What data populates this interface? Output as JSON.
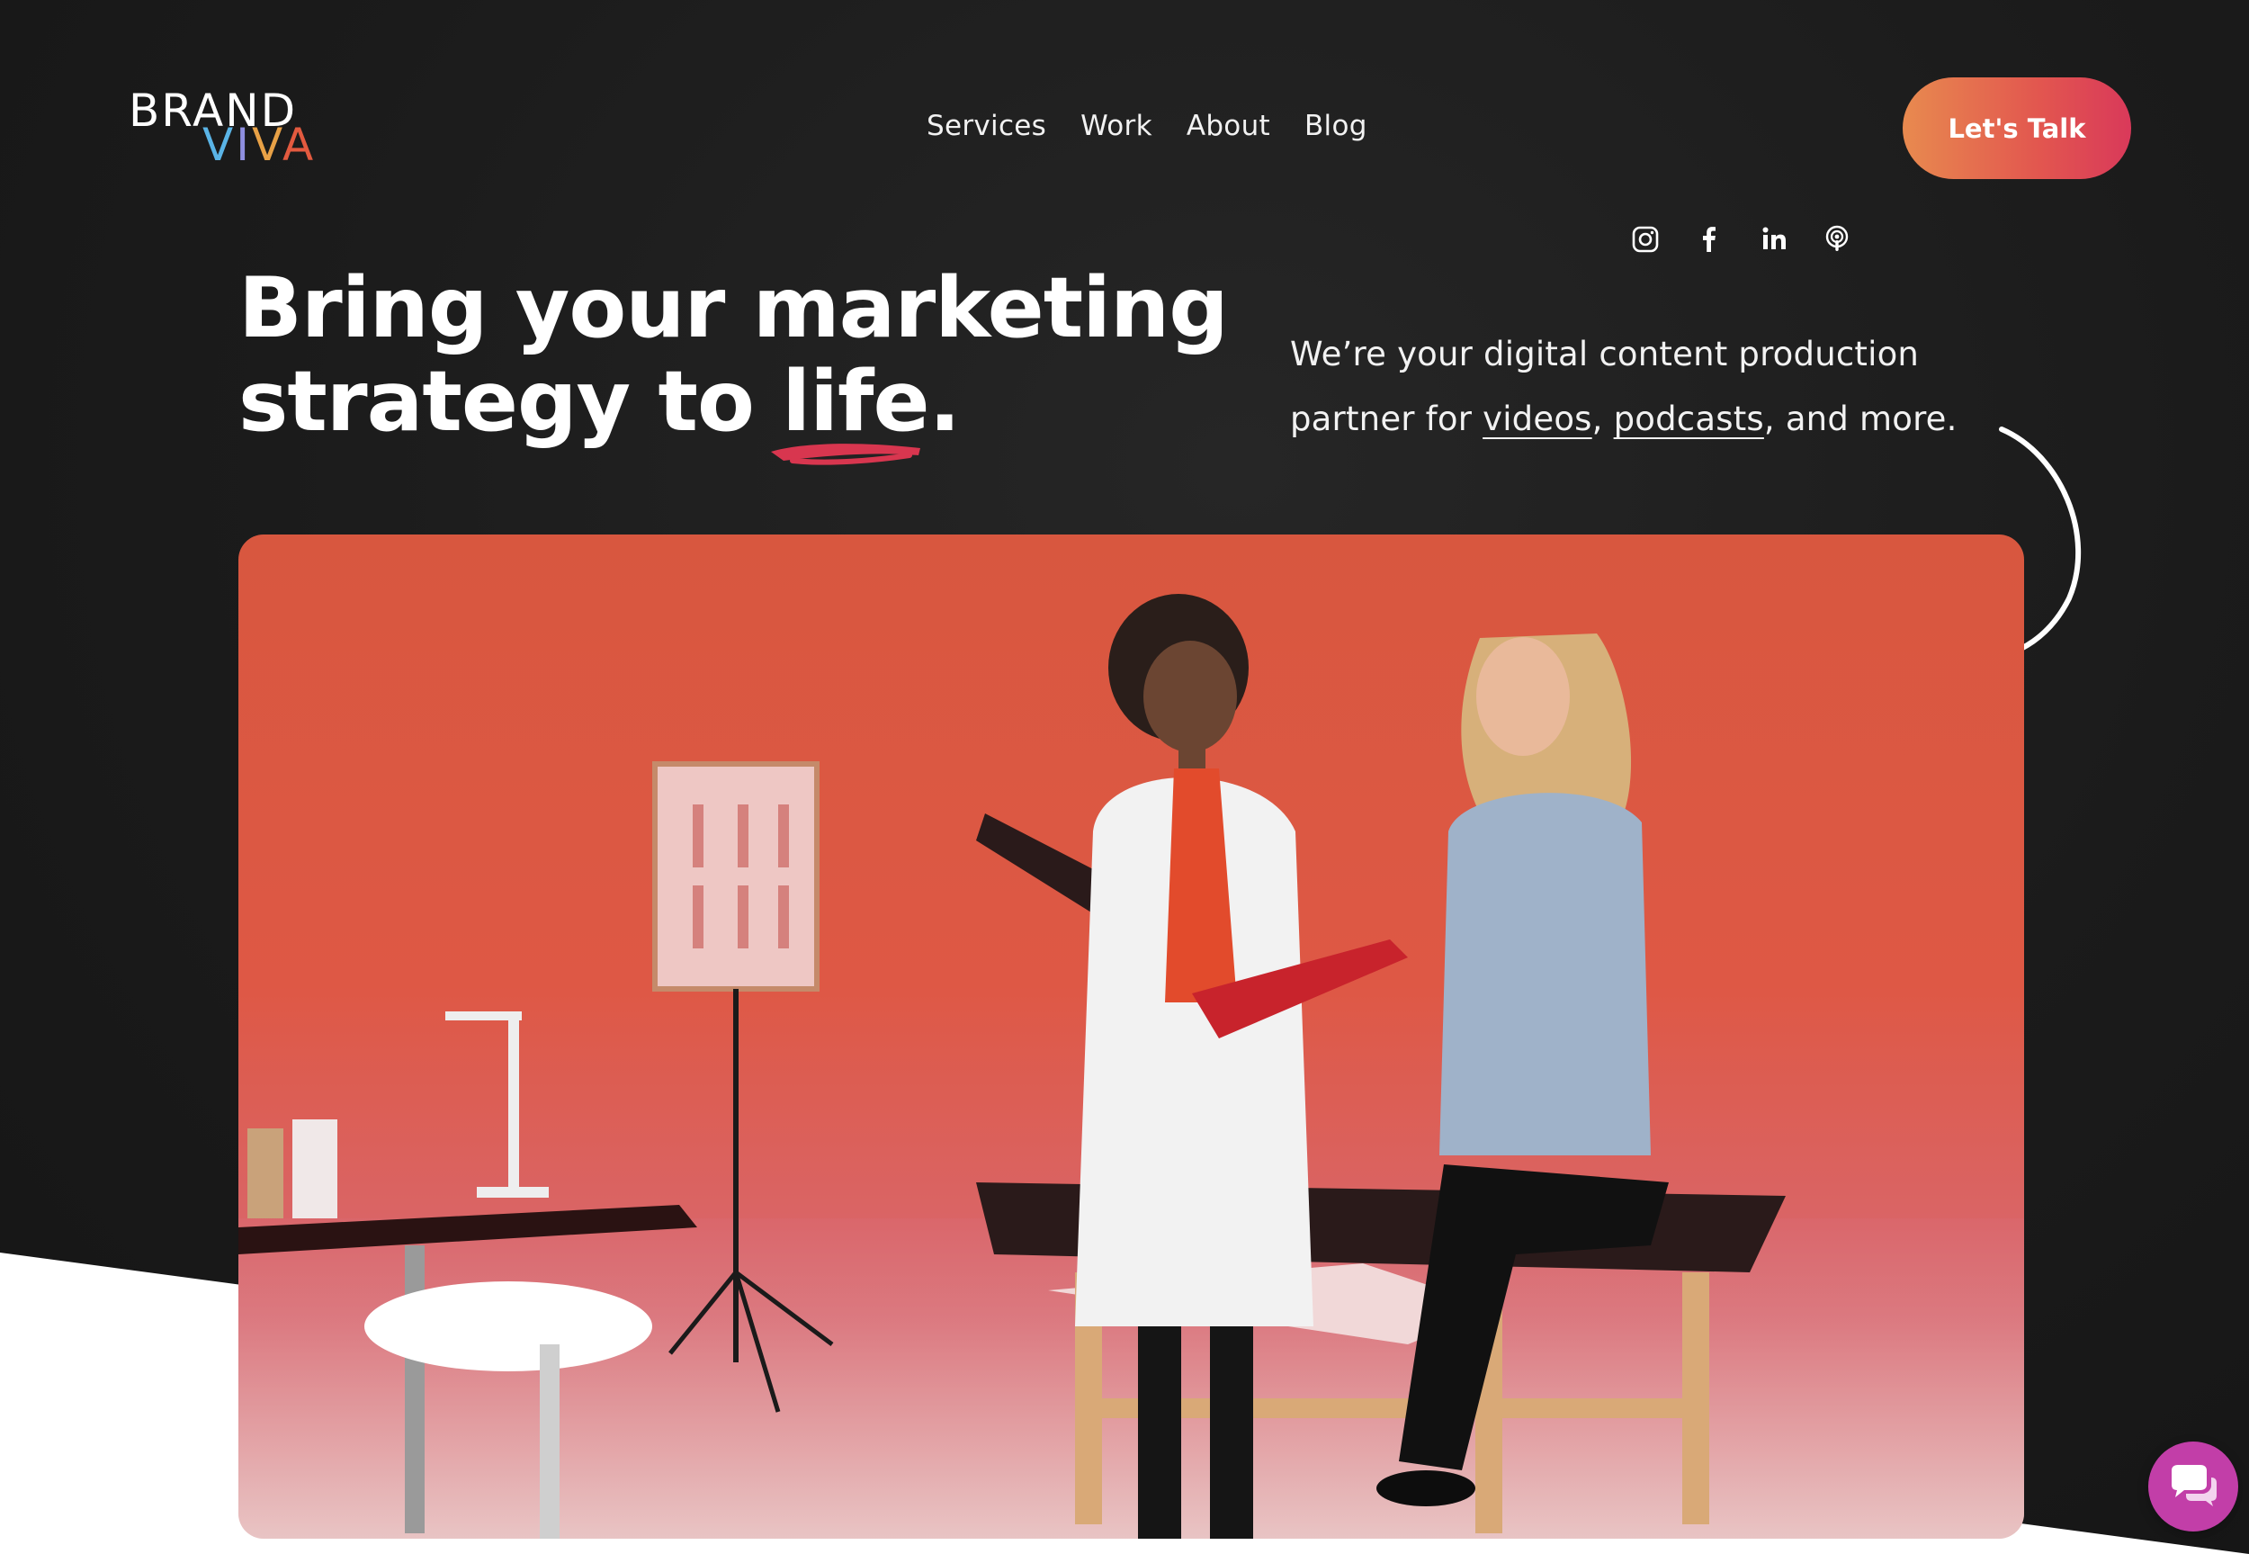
{
  "brand": {
    "logo_line1": "BRAND",
    "logo_line2_letters": [
      "V",
      "I",
      "V",
      "A"
    ]
  },
  "nav": {
    "items": [
      {
        "label": "Services"
      },
      {
        "label": "Work"
      },
      {
        "label": "About"
      },
      {
        "label": "Blog"
      }
    ]
  },
  "social": {
    "icons": [
      "instagram-icon",
      "facebook-icon",
      "linkedin-icon",
      "podcast-icon"
    ]
  },
  "cta": {
    "label": "Let's Talk"
  },
  "hero": {
    "headline_line1": "Bring your marketing",
    "headline_line2_pre": "strategy to ",
    "headline_highlight": "life",
    "headline_end": ".",
    "tagline_pre": "We’re your digital content production partner for ",
    "tagline_link1": "videos",
    "tagline_mid": ", ",
    "tagline_link2": "podcasts",
    "tagline_post": ", and more."
  },
  "chat": {
    "icon": "chat-icon"
  },
  "colors": {
    "background": "#1c1c1c",
    "accent_start": "#e88a4f",
    "accent_end": "#d9395a",
    "chat": "#c23ea8"
  }
}
